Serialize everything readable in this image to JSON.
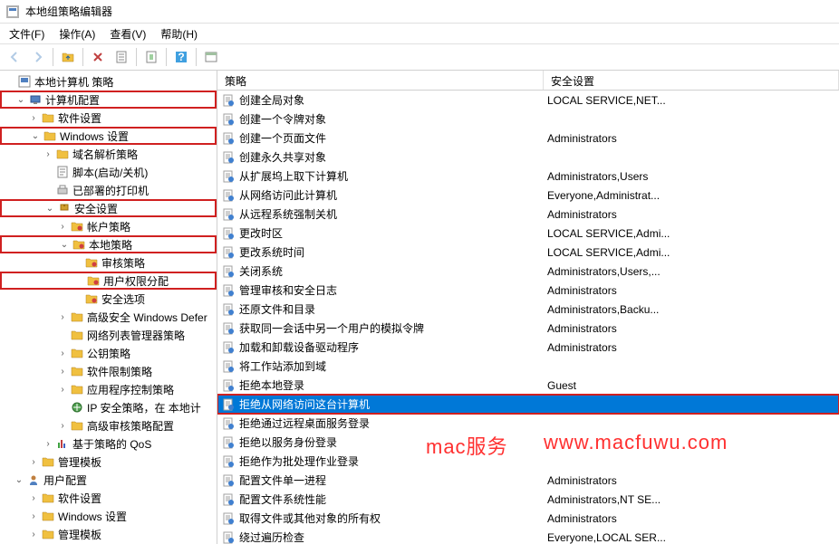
{
  "window": {
    "title": "本地组策略编辑器"
  },
  "menu": {
    "file": "文件(F)",
    "action": "操作(A)",
    "view": "查看(V)",
    "help": "帮助(H)"
  },
  "toolbar": {
    "back": "back-icon",
    "forward": "forward-icon",
    "up": "up-icon",
    "copy": "copy-icon",
    "delete": "delete-icon",
    "properties": "properties-icon",
    "refresh": "refresh-icon",
    "help": "help-icon",
    "extra": "extra-icon"
  },
  "columns": {
    "policy": "策略",
    "security_setting": "安全设置"
  },
  "tree": {
    "root": "本地计算机 策略",
    "computer_config": "计算机配置",
    "software_settings": "软件设置",
    "windows_settings": "Windows 设置",
    "name_resolution_policy": "域名解析策略",
    "scripts": "脚本(启动/关机)",
    "deployed_printers": "已部署的打印机",
    "security_settings": "安全设置",
    "account_policies": "帐户策略",
    "local_policies": "本地策略",
    "audit_policy": "审核策略",
    "user_rights_assignment": "用户权限分配",
    "security_options": "安全选项",
    "windows_defender": "高级安全 Windows Defer",
    "network_list_manager": "网络列表管理器策略",
    "public_key_policies": "公钥策略",
    "software_restriction": "软件限制策略",
    "app_control_policies": "应用程序控制策略",
    "ip_security": "IP 安全策略，在 本地计",
    "advanced_audit": "高级审核策略配置",
    "qos": "基于策略的 QoS",
    "admin_templates": "管理模板",
    "user_config": "用户配置",
    "software_settings2": "软件设置",
    "windows_settings2": "Windows 设置",
    "admin_templates2": "管理模板"
  },
  "policies": [
    {
      "name": "创建全局对象",
      "value": "LOCAL SERVICE,NET..."
    },
    {
      "name": "创建一个令牌对象",
      "value": ""
    },
    {
      "name": "创建一个页面文件",
      "value": "Administrators"
    },
    {
      "name": "创建永久共享对象",
      "value": ""
    },
    {
      "name": "从扩展坞上取下计算机",
      "value": "Administrators,Users"
    },
    {
      "name": "从网络访问此计算机",
      "value": "Everyone,Administrat..."
    },
    {
      "name": "从远程系统强制关机",
      "value": "Administrators"
    },
    {
      "name": "更改时区",
      "value": "LOCAL SERVICE,Admi..."
    },
    {
      "name": "更改系统时间",
      "value": "LOCAL SERVICE,Admi..."
    },
    {
      "name": "关闭系统",
      "value": "Administrators,Users,..."
    },
    {
      "name": "管理审核和安全日志",
      "value": "Administrators"
    },
    {
      "name": "还原文件和目录",
      "value": "Administrators,Backu..."
    },
    {
      "name": "获取同一会话中另一个用户的模拟令牌",
      "value": "Administrators"
    },
    {
      "name": "加载和卸载设备驱动程序",
      "value": "Administrators"
    },
    {
      "name": "将工作站添加到域",
      "value": ""
    },
    {
      "name": "拒绝本地登录",
      "value": "Guest"
    },
    {
      "name": "拒绝从网络访问这台计算机",
      "value": "",
      "selected": true
    },
    {
      "name": "拒绝通过远程桌面服务登录",
      "value": ""
    },
    {
      "name": "拒绝以服务身份登录",
      "value": ""
    },
    {
      "name": "拒绝作为批处理作业登录",
      "value": ""
    },
    {
      "name": "配置文件单一进程",
      "value": "Administrators"
    },
    {
      "name": "配置文件系统性能",
      "value": "Administrators,NT SE..."
    },
    {
      "name": "取得文件或其他对象的所有权",
      "value": "Administrators"
    },
    {
      "name": "绕过遍历检查",
      "value": "Everyone,LOCAL SER..."
    }
  ],
  "watermark": {
    "text1": "mac服务",
    "text2": "www.macfuwu.com"
  }
}
